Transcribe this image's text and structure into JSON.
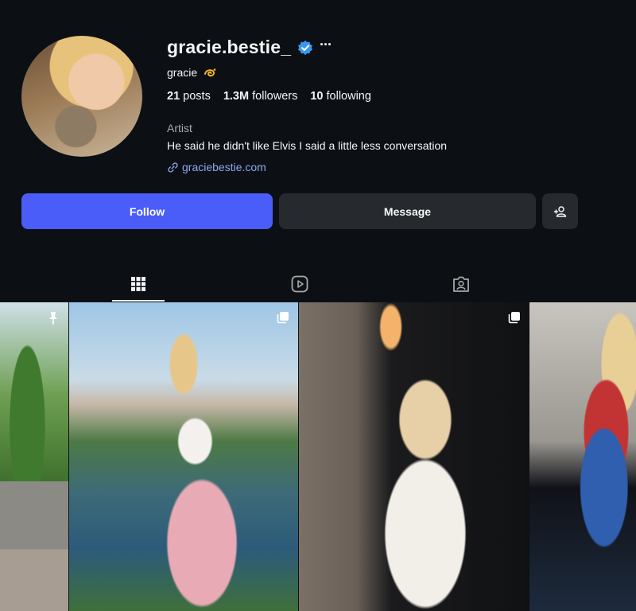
{
  "profile": {
    "username": "gracie.bestie_",
    "display_name": "gracie",
    "display_name_emoji": "dizzy-emoji",
    "verified": true,
    "more_label": "···",
    "stats": {
      "posts_count": "21",
      "posts_label": "posts",
      "followers_count": "1.3M",
      "followers_label": "followers",
      "following_count": "10",
      "following_label": "following"
    },
    "category": "Artist",
    "bio": "He said he didn't like Elvis I said a little less conversation",
    "link": "graciebestie.com"
  },
  "actions": {
    "follow_label": "Follow",
    "message_label": "Message",
    "suggest_icon": "add-person-icon"
  },
  "tabs": [
    {
      "icon": "grid-icon",
      "active": true
    },
    {
      "icon": "reels-icon",
      "active": false
    },
    {
      "icon": "tagged-icon",
      "active": false
    }
  ],
  "posts": [
    {
      "badge": "pinned-icon"
    },
    {
      "badge": "carousel-icon"
    },
    {
      "badge": "carousel-icon"
    },
    {
      "badge": ""
    }
  ],
  "colors": {
    "background": "#0c1015",
    "follow_button": "#4a5df9",
    "secondary_button": "#26292e",
    "link": "#8ba8f0",
    "verified_badge": "#3897f0"
  }
}
